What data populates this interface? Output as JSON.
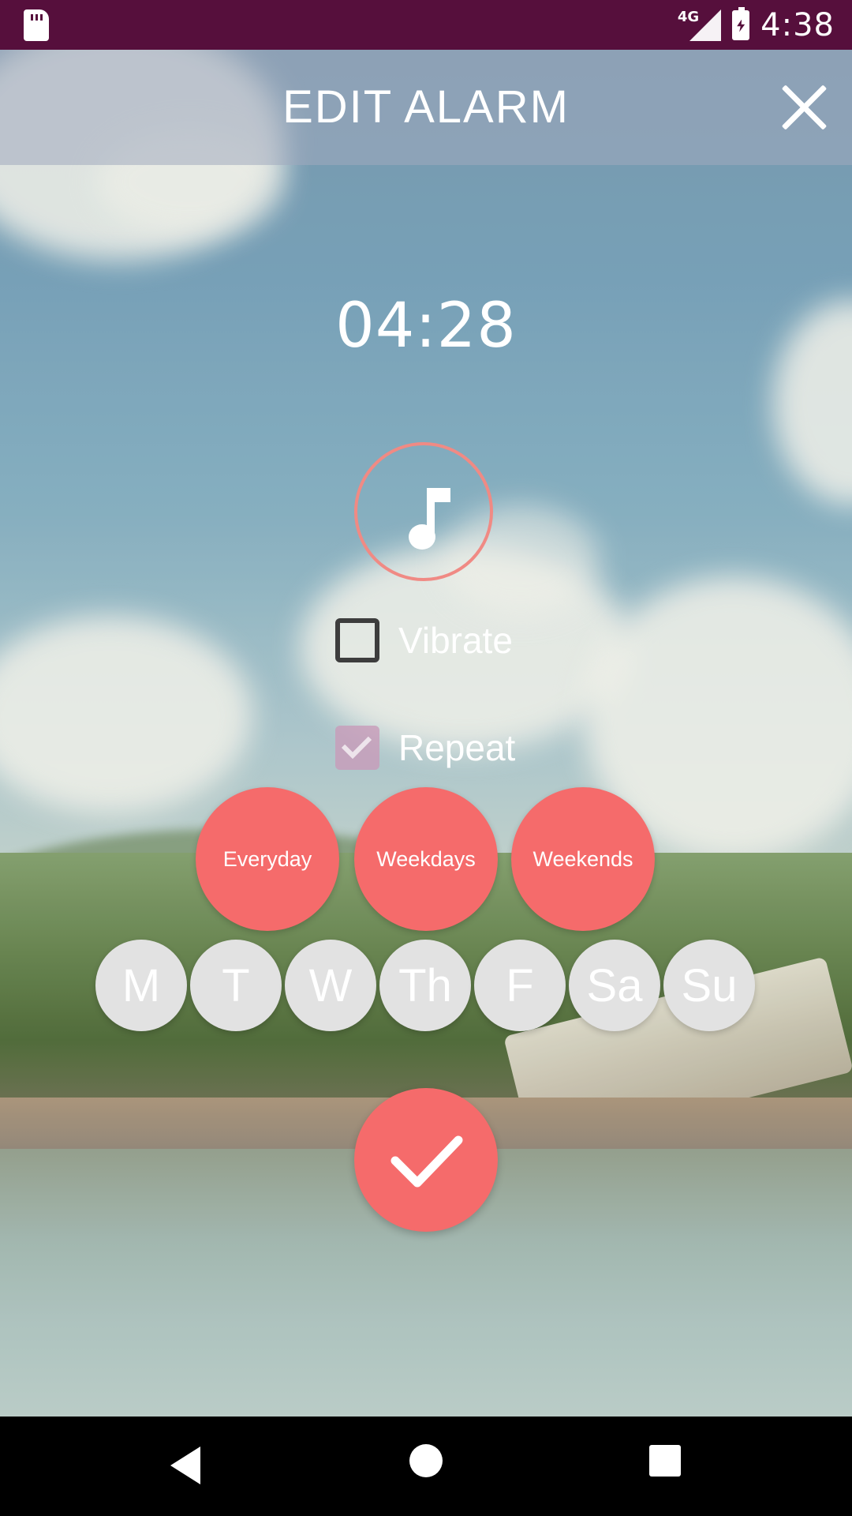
{
  "status_bar": {
    "network_label": "4G",
    "time": "4:38",
    "icons": [
      "sd-card-icon",
      "signal-icon",
      "battery-charging-icon"
    ]
  },
  "header": {
    "title": "EDIT ALARM",
    "close_icon": "close-icon"
  },
  "alarm": {
    "time": "04:28",
    "sound_icon": "music-note-icon",
    "vibrate": {
      "label": "Vibrate",
      "checked": false
    },
    "repeat": {
      "label": "Repeat",
      "checked": true
    }
  },
  "presets": [
    {
      "label": "Everyday"
    },
    {
      "label": "Weekdays"
    },
    {
      "label": "Weekends"
    }
  ],
  "days": [
    {
      "label": "M"
    },
    {
      "label": "T"
    },
    {
      "label": "W"
    },
    {
      "label": "Th"
    },
    {
      "label": "F"
    },
    {
      "label": "Sa"
    },
    {
      "label": "Su"
    }
  ],
  "confirm": {
    "icon": "checkmark-icon"
  },
  "colors": {
    "status_bar": "#560f3c",
    "accent": "#f56b6b",
    "accent_ring": "#f08a84",
    "day_circle": "#e2e2e2",
    "nav_bar": "#000000"
  },
  "nav_bar": {
    "icons": [
      "back-icon",
      "home-icon",
      "recents-icon"
    ]
  }
}
